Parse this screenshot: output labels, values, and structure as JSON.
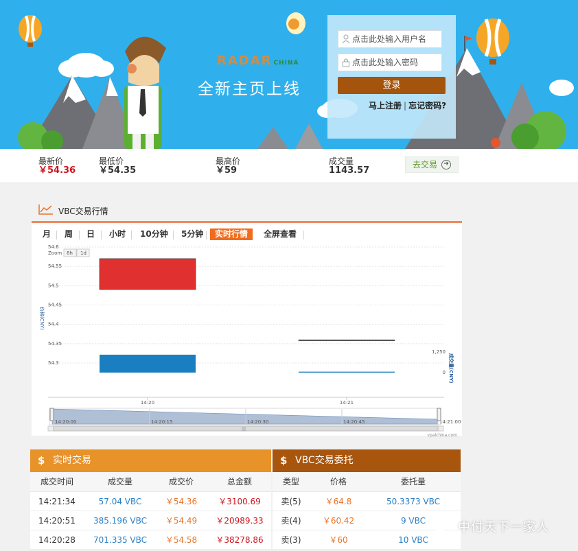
{
  "hero": {
    "brand": "RADAR",
    "brand_sub": "CHINA",
    "headline": "全新主页上线"
  },
  "login": {
    "username_placeholder": "点击此处输入用户名",
    "password_placeholder": "点击此处输入密码",
    "submit_label": "登录",
    "register_label": "马上注册",
    "separator": "|",
    "forgot_label": "忘记密码?"
  },
  "stats": {
    "latest_label": "最新价",
    "latest_value": "￥54.36",
    "low_label": "最低价",
    "low_value": "￥54.35",
    "high_label": "最高价",
    "high_value": "￥59",
    "volume_label": "成交量",
    "volume_value": "1143.57",
    "trade_label": "去交易"
  },
  "chart_section": {
    "title": "VBC交易行情",
    "tabs": [
      "月",
      "周",
      "日",
      "小时",
      "10分钟",
      "5分钟",
      "实时行情",
      "全屏查看"
    ],
    "active_tab": "实时行情",
    "zoom_label": "Zoom",
    "zoom_options": [
      "8h",
      "1d"
    ],
    "credit": "vpalchina.com"
  },
  "chart_data": {
    "type": "candlestick",
    "ylabel": "价格(CNY)",
    "y2label": "成交量(CNY)",
    "ylim": [
      54.3,
      54.6
    ],
    "y_ticks": [
      "54.6",
      "54.55",
      "54.5",
      "54.45",
      "54.4",
      "54.35",
      "54.3"
    ],
    "y2_ticks": [
      "1,250",
      "0"
    ],
    "x_ticks": [
      "14:20",
      "14:21"
    ],
    "navigator_ticks": [
      "14:20:00",
      "14:20:15",
      "14:20:30",
      "14:20:45",
      "14:21:00"
    ],
    "candles": [
      {
        "time": "14:20",
        "open": 54.57,
        "close": 54.49,
        "color": "#e03030"
      },
      {
        "time": "14:21",
        "open": 54.36,
        "close": 54.36,
        "color": "#555555"
      }
    ],
    "volume": [
      {
        "time": "14:20",
        "value": 1087,
        "color": "#1a7fc0"
      },
      {
        "time": "14:21",
        "value": 57,
        "color": "#1a7fc0"
      }
    ]
  },
  "trades": {
    "title": "实时交易",
    "header_color": "#e8922a",
    "columns": [
      "成交时间",
      "成交量",
      "成交价",
      "总金额"
    ],
    "rows": [
      [
        "14:21:34",
        "57.04 VBC",
        "￥54.36",
        "￥3100.69"
      ],
      [
        "14:20:51",
        "385.196 VBC",
        "￥54.49",
        "￥20989.33"
      ],
      [
        "14:20:28",
        "701.335 VBC",
        "￥54.58",
        "￥38278.86"
      ]
    ]
  },
  "orders": {
    "title": "VBC交易委托",
    "header_color": "#a8560e",
    "columns": [
      "类型",
      "价格",
      "委托量"
    ],
    "rows": [
      [
        "卖(5)",
        "￥64.8",
        "50.3373 VBC"
      ],
      [
        "卖(4)",
        "￥60.42",
        "9 VBC"
      ],
      [
        "卖(3)",
        "￥60",
        "10 VBC"
      ]
    ]
  },
  "watermark": "中付天下一家人"
}
